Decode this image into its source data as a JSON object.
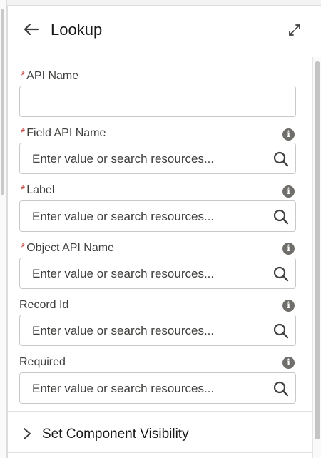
{
  "header": {
    "title": "Lookup",
    "back_icon": "arrow-left-icon",
    "expand_icon": "expand-icon"
  },
  "fields": [
    {
      "label": "API Name",
      "required": true,
      "info": false,
      "placeholder": ""
    },
    {
      "label": "Field API Name",
      "required": true,
      "info": true,
      "placeholder": "Enter value or search resources..."
    },
    {
      "label": "Label",
      "required": true,
      "info": true,
      "placeholder": "Enter value or search resources..."
    },
    {
      "label": "Object API Name",
      "required": true,
      "info": true,
      "placeholder": "Enter value or search resources..."
    },
    {
      "label": "Record Id",
      "required": false,
      "info": true,
      "placeholder": "Enter value or search resources..."
    },
    {
      "label": "Required",
      "required": false,
      "info": true,
      "placeholder": "Enter value or search resources..."
    }
  ],
  "required_marker": "*",
  "info_glyph": "i",
  "section": {
    "label": "Set Component Visibility"
  },
  "colors": {
    "required": "#c23934",
    "info": "#706e6b",
    "border": "#c9c9c9"
  }
}
